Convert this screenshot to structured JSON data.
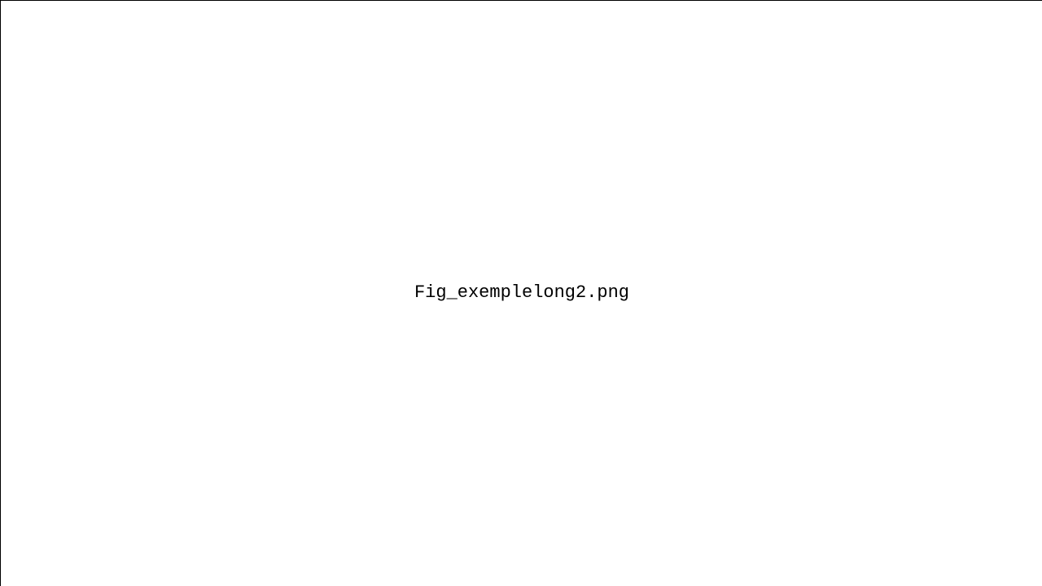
{
  "figure": {
    "filename_label": "Fig_exemplelong2.png"
  }
}
